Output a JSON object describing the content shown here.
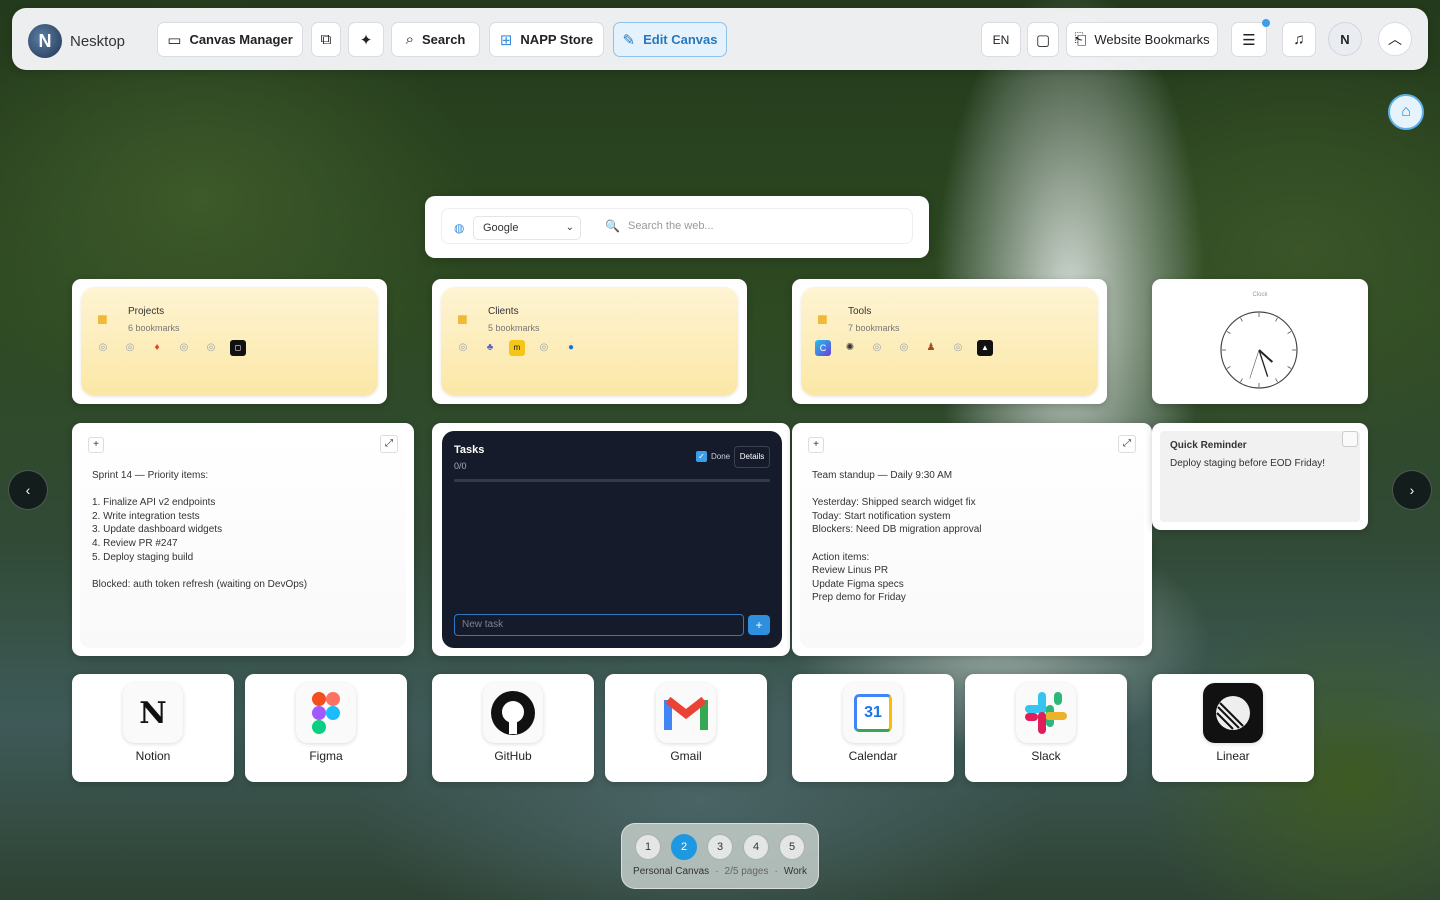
{
  "app": {
    "name": "Nesktop",
    "logo_letter": "N"
  },
  "toolbar": {
    "canvas_manager": "Canvas Manager",
    "search": "Search",
    "napp_store": "NAPP Store",
    "edit_canvas": "Edit Canvas",
    "language": "EN",
    "website_bookmarks": "Website Bookmarks",
    "user_initial": "N"
  },
  "search_widget": {
    "engine": "Google",
    "placeholder": "Search the web..."
  },
  "folders": [
    {
      "title": "Projects",
      "count": "6 bookmarks"
    },
    {
      "title": "Clients",
      "count": "5 bookmarks"
    },
    {
      "title": "Tools",
      "count": "7 bookmarks"
    }
  ],
  "clock": {
    "label": "Clock",
    "hour": 4.4,
    "minute": 27,
    "second": 33
  },
  "notes": [
    {
      "text": "Sprint 14 — Priority items:\n\n1. Finalize API v2 endpoints\n2. Write integration tests\n3. Update dashboard widgets\n4. Review PR #247\n5. Deploy staging build\n\nBlocked: auth token refresh (waiting on DevOps)"
    },
    {
      "text": "Team standup — Daily 9:30 AM\n\nYesterday: Shipped search widget fix\nToday: Start notification system\nBlockers: Need DB migration approval\n\nAction items:\nReview Linus PR\nUpdate Figma specs\nPrep demo for Friday"
    }
  ],
  "tasks": {
    "title": "Tasks",
    "count": "0/0",
    "done_label": "Done",
    "details_label": "Details",
    "input_placeholder": "New task",
    "add_label": "+"
  },
  "reminder": {
    "title": "Quick Reminder",
    "text": "Deploy staging before EOD Friday!"
  },
  "apps": [
    {
      "name": "Notion"
    },
    {
      "name": "Figma"
    },
    {
      "name": "GitHub"
    },
    {
      "name": "Gmail"
    },
    {
      "name": "Calendar",
      "day": "31"
    },
    {
      "name": "Slack"
    },
    {
      "name": "Linear"
    }
  ],
  "pager": {
    "pages": [
      "1",
      "2",
      "3",
      "4",
      "5"
    ],
    "current": 2,
    "left_label": "Personal Canvas",
    "status": "2/5 pages",
    "right_label": "Work"
  },
  "colors": {
    "accent": "#1e98e0",
    "folder": "#fbe7a6",
    "tasks_bg": "#161b2b"
  }
}
